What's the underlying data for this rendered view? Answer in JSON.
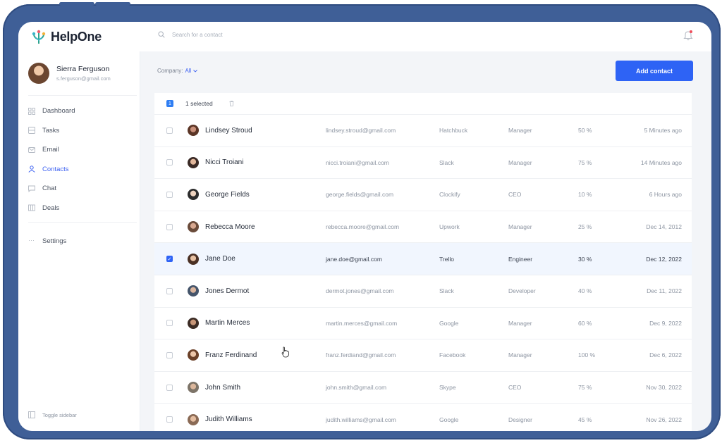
{
  "app": {
    "name": "HelpOne"
  },
  "user": {
    "name": "Sierra Ferguson",
    "email": "s.ferguson@gmail.com"
  },
  "nav": {
    "items": [
      {
        "label": "Dashboard",
        "icon": "grid-icon",
        "active": false
      },
      {
        "label": "Tasks",
        "icon": "tasks-icon",
        "active": false
      },
      {
        "label": "Email",
        "icon": "mail-icon",
        "active": false
      },
      {
        "label": "Contacts",
        "icon": "user-icon",
        "active": true
      },
      {
        "label": "Chat",
        "icon": "chat-icon",
        "active": false
      },
      {
        "label": "Deals",
        "icon": "deals-icon",
        "active": false
      }
    ],
    "settings": "Settings",
    "toggle": "Toggle sidebar"
  },
  "search": {
    "placeholder": "Search for a contact"
  },
  "filter": {
    "label": "Company:",
    "value": "All"
  },
  "actions": {
    "add_contact": "Add contact"
  },
  "selection": {
    "count_badge": "1",
    "label": "1 selected"
  },
  "contacts": [
    {
      "name": "Lindsey Stroud",
      "email": "lindsey.stroud@gmail.com",
      "company": "Hatchbuck",
      "role": "Manager",
      "percent": "50 %",
      "date": "5 Minutes ago",
      "selected": false
    },
    {
      "name": "Nicci Troiani",
      "email": "nicci.troiani@gmail.com",
      "company": "Slack",
      "role": "Manager",
      "percent": "75 %",
      "date": "14 Minutes ago",
      "selected": false
    },
    {
      "name": "George Fields",
      "email": "george.fields@gmail.com",
      "company": "Clockify",
      "role": "CEO",
      "percent": "10 %",
      "date": "6 Hours ago",
      "selected": false
    },
    {
      "name": "Rebecca Moore",
      "email": "rebecca.moore@gmail.com",
      "company": "Upwork",
      "role": "Manager",
      "percent": "25 %",
      "date": "Dec 14, 2012",
      "selected": false
    },
    {
      "name": "Jane Doe",
      "email": "jane.doe@gmail.com",
      "company": "Trello",
      "role": "Engineer",
      "percent": "30 %",
      "date": "Dec 12, 2022",
      "selected": true
    },
    {
      "name": "Jones Dermot",
      "email": "dermot.jones@gmail.com",
      "company": "Slack",
      "role": "Developer",
      "percent": "40 %",
      "date": "Dec 11, 2022",
      "selected": false
    },
    {
      "name": "Martin Merces",
      "email": "martin.merces@gmail.com",
      "company": "Google",
      "role": "Manager",
      "percent": "60 %",
      "date": "Dec 9, 2022",
      "selected": false
    },
    {
      "name": "Franz Ferdinand",
      "email": "franz.ferdiand@gmail.com",
      "company": "Facebook",
      "role": "Manager",
      "percent": "100 %",
      "date": "Dec 6, 2022",
      "selected": false
    },
    {
      "name": "John Smith",
      "email": "john.smith@gmail.com",
      "company": "Skype",
      "role": "CEO",
      "percent": "75 %",
      "date": "Nov 30, 2022",
      "selected": false
    },
    {
      "name": "Judith Williams",
      "email": "judith.williams@gmail.com",
      "company": "Google",
      "role": "Designer",
      "percent": "45 %",
      "date": "Nov 26, 2022",
      "selected": false
    }
  ],
  "colors": {
    "accent": "#2e63f5",
    "frame": "#3f5f97",
    "active_nav": "#3f63f2",
    "selected_row": "#f1f6fe"
  }
}
